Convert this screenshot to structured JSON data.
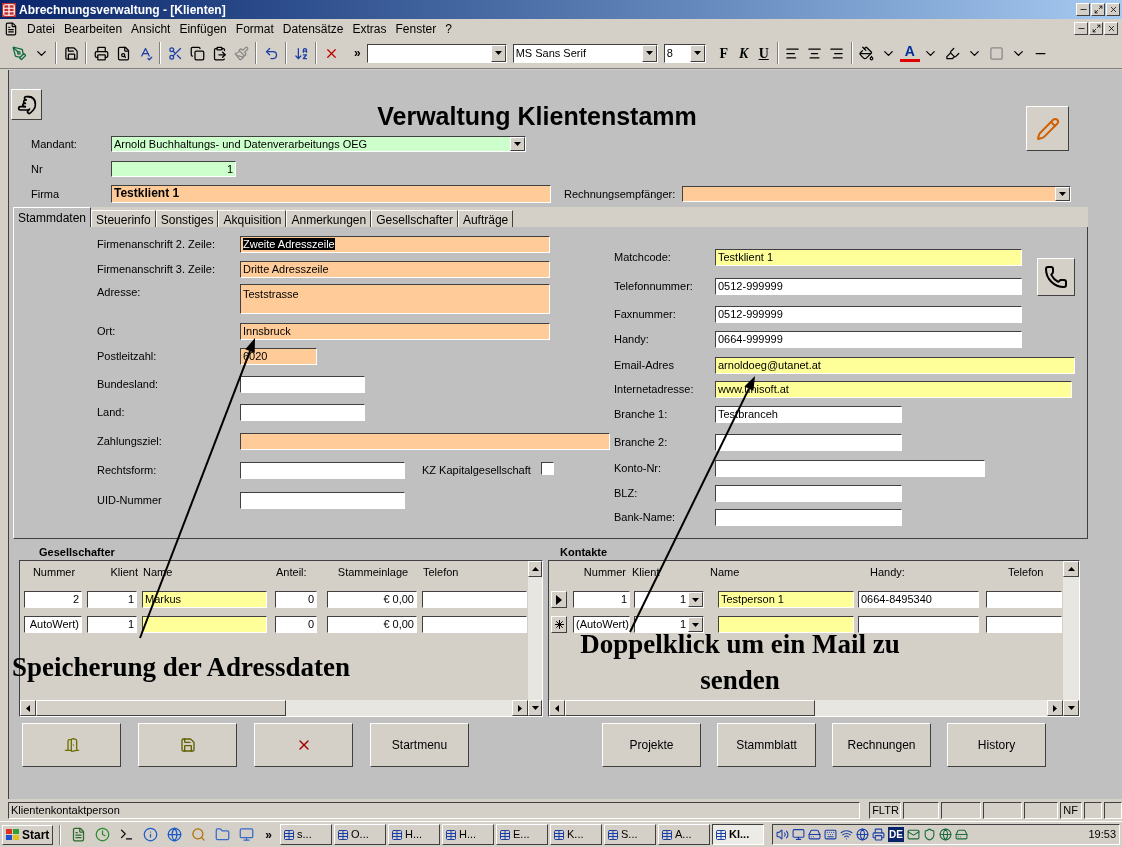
{
  "window": {
    "title": "Abrechnungsverwaltung - [Klienten]"
  },
  "menu": {
    "items": [
      "Datei",
      "Bearbeiten",
      "Ansicht",
      "Einfügen",
      "Format",
      "Datensätze",
      "Extras",
      "Fenster",
      "?"
    ]
  },
  "toolbar": {
    "more": "»",
    "font_name": "MS Sans Serif",
    "font_size": "8",
    "bold": "F",
    "italic": "K",
    "underline": "U",
    "font_color": "A"
  },
  "form": {
    "title": "Verwaltung Klientenstamm",
    "header_fields": [
      {
        "label": "Mandant:",
        "value": "Arnold Buchhaltungs- und Datenverarbeitungs OEG",
        "color": "#ccffcc",
        "kind": "combo"
      },
      {
        "label": "Nr",
        "value": "1",
        "color": "#ccffcc",
        "kind": "number"
      },
      {
        "label": "Firma",
        "value": "Testklient 1",
        "color": "#ffcc99",
        "kind": "text"
      }
    ],
    "rechnungsempfaenger": {
      "label": "Rechnungsempfänger:",
      "color": "#ffcc99"
    },
    "tabs": [
      {
        "label": "Stammdaten",
        "selected": true
      },
      {
        "label": "Steuerinfo",
        "selected": false
      },
      {
        "label": "Sonstiges",
        "selected": false
      },
      {
        "label": "Akquisition",
        "selected": false
      },
      {
        "label": "Anmerkungen",
        "selected": false
      },
      {
        "label": "Gesellschafter",
        "selected": false
      },
      {
        "label": "Aufträge",
        "selected": false
      }
    ],
    "left_fields": [
      {
        "label": "Firmenanschrift 2. Zeile:",
        "value": "Zweite Adresszeile",
        "color": "#ffcc99",
        "text_selected": true
      },
      {
        "label": "Firmenanschrift 3. Zeile:",
        "value": "Dritte Adresszeile",
        "color": "#ffcc99",
        "text_selected": false
      },
      {
        "label": "Adresse:",
        "value": "Teststrasse",
        "color": "#ffcc99",
        "text_selected": false
      },
      {
        "label": "Ort:",
        "value": "Innsbruck",
        "color": "#ffcc99",
        "text_selected": false
      },
      {
        "label": "Postleitzahl:",
        "value": "6020",
        "color": "#ffcc99",
        "text_selected": false
      },
      {
        "label": "Bundesland:",
        "color": "#ffffff"
      },
      {
        "label": "Land:",
        "color": "#ffffff"
      },
      {
        "label": "Zahlungsziel:",
        "color": "#ffcc99"
      },
      {
        "label": "Rechtsform:",
        "color": "#ffffff",
        "checkbox": {
          "label": "KZ Kapitalgesellschaft",
          "checked": false
        }
      },
      {
        "label": "UID-Nummer",
        "color": "#ffffff"
      }
    ],
    "right_fields": [
      {
        "label": "Matchcode:",
        "value": "Testklient 1",
        "color": "#ffff99",
        "text_selected": false
      },
      {
        "label": "Telefonnummer:",
        "value": "0512-999999",
        "color": "#ffffff",
        "text_selected": false
      },
      {
        "label": "Faxnummer:",
        "value": "0512-999999",
        "color": "#ffffff",
        "text_selected": false
      },
      {
        "label": "Handy:",
        "value": "0664-999999",
        "color": "#ffffff",
        "text_selected": false
      },
      {
        "label": "Email-Adres",
        "value": "arnoldoeg@utanet.at",
        "color": "#ffff99",
        "text_selected": false
      },
      {
        "label": "Internetadresse:",
        "value": "www.unisoft.at",
        "color": "#ffff99",
        "text_selected": false
      },
      {
        "label": "Branche 1:",
        "value": "Testbranceh",
        "color": "#ffffff",
        "text_selected": false
      },
      {
        "label": "Branche 2:",
        "color": "#ffffff"
      },
      {
        "label": "Konto-Nr:",
        "color": "#ffffff"
      },
      {
        "label": "BLZ:",
        "color": "#ffffff"
      },
      {
        "label": "Bank-Name:",
        "color": "#ffffff"
      }
    ]
  },
  "gesellschafter": {
    "title": "Gesellschafter",
    "columns": [
      "Nummer",
      "Klient",
      "Name",
      "Anteil:",
      "Stammeinlage",
      "Telefon"
    ],
    "rows": [
      {
        "nummer": "2",
        "klient": "1",
        "name": "Markus",
        "anteil": "0",
        "stammeinlage": "€ 0,00"
      },
      {
        "nummer": "AutoWert)",
        "klient": "1",
        "anteil": "0",
        "stammeinlage": "€ 0,00"
      }
    ]
  },
  "kontakte": {
    "title": "Kontakte",
    "columns": [
      "Nummer",
      "Klient",
      "Name",
      "Handy:",
      "Telefon"
    ],
    "rows": [
      {
        "kind": "current",
        "nummer": "1",
        "klient": "1",
        "name": "Testperson 1",
        "handy": "0664-8495340"
      },
      {
        "kind": "new",
        "nummer": "(AutoWert)",
        "klient": "1"
      }
    ]
  },
  "buttons": [
    {
      "kind": "exit"
    },
    {
      "kind": "save"
    },
    {
      "kind": "delete"
    },
    {
      "kind": "text",
      "label": "Startmenu"
    },
    {
      "kind": "text",
      "label": "Projekte"
    },
    {
      "kind": "text",
      "label": "Stammblatt"
    },
    {
      "kind": "text",
      "label": "Rechnungen"
    },
    {
      "kind": "text",
      "label": "History"
    }
  ],
  "annotations": [
    {
      "text": "Speicherung der Adressdaten"
    },
    {
      "text": "Doppelklick um ein Mail zu senden"
    }
  ],
  "status_bar": {
    "text": "Klientenkontaktperson",
    "indicators": [
      "FLTR",
      "NF"
    ]
  },
  "taskbar": {
    "start": "Start",
    "more": "»",
    "tasks": [
      {
        "label": "s...",
        "selected": false
      },
      {
        "label": "O...",
        "selected": false
      },
      {
        "label": "H...",
        "selected": false
      },
      {
        "label": "H...",
        "selected": false
      },
      {
        "label": "E...",
        "selected": false
      },
      {
        "label": "K...",
        "selected": false
      },
      {
        "label": "S...",
        "selected": false
      },
      {
        "label": "A...",
        "selected": false
      },
      {
        "label": "Kl...",
        "selected": true
      }
    ],
    "language": "DE",
    "clock": "19:53"
  }
}
